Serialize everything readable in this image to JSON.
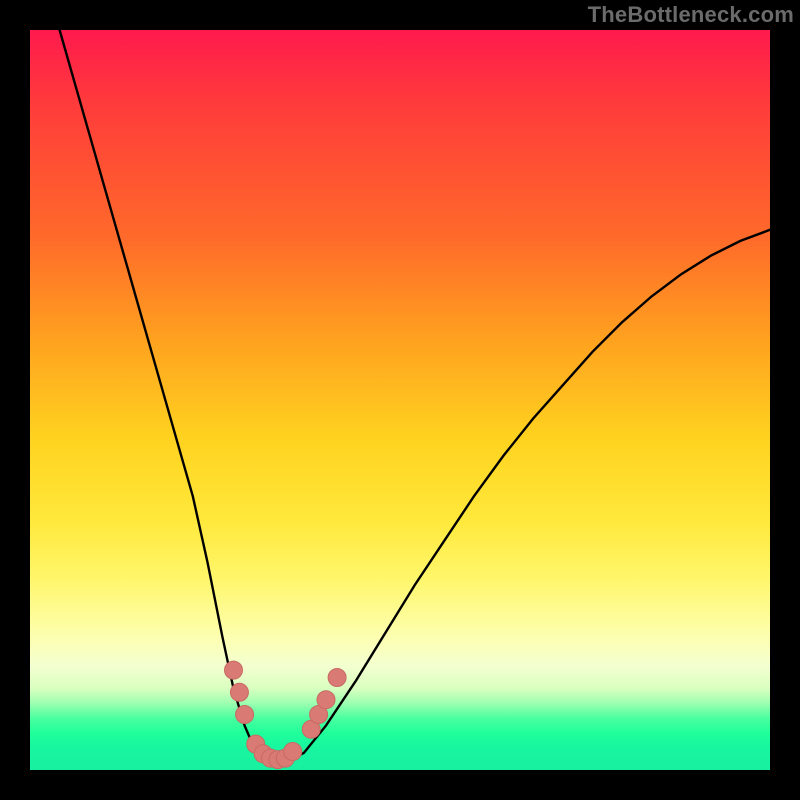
{
  "watermark": "TheBottleneck.com",
  "colors": {
    "frame": "#000000",
    "curve": "#000000",
    "marker_fill": "#d97b74",
    "marker_stroke": "#c86a63"
  },
  "chart_data": {
    "type": "line",
    "title": "",
    "xlabel": "",
    "ylabel": "",
    "xlim": [
      0,
      100
    ],
    "ylim": [
      0,
      100
    ],
    "series": [
      {
        "name": "bottleneck-curve",
        "x": [
          4,
          6,
          8,
          10,
          12,
          14,
          16,
          18,
          20,
          22,
          24,
          26,
          27.5,
          29,
          30.5,
          32,
          33.5,
          34,
          35,
          37,
          40,
          44,
          48,
          52,
          56,
          60,
          64,
          68,
          72,
          76,
          80,
          84,
          88,
          92,
          96,
          100
        ],
        "values": [
          100,
          93,
          86,
          79,
          72,
          65,
          58,
          51,
          44,
          37,
          28,
          18,
          11,
          6,
          2.5,
          1.3,
          1.1,
          1.1,
          1.3,
          2.3,
          6,
          12,
          18.5,
          25,
          31,
          37,
          42.5,
          47.5,
          52,
          56.5,
          60.5,
          64,
          67,
          69.5,
          71.5,
          73
        ]
      }
    ],
    "markers": [
      {
        "x": 27.5,
        "y": 13.5
      },
      {
        "x": 28.3,
        "y": 10.5
      },
      {
        "x": 29.0,
        "y": 7.5
      },
      {
        "x": 30.5,
        "y": 3.5
      },
      {
        "x": 31.5,
        "y": 2.2
      },
      {
        "x": 32.5,
        "y": 1.6
      },
      {
        "x": 33.5,
        "y": 1.4
      },
      {
        "x": 34.5,
        "y": 1.6
      },
      {
        "x": 35.5,
        "y": 2.5
      },
      {
        "x": 38.0,
        "y": 5.5
      },
      {
        "x": 39.0,
        "y": 7.5
      },
      {
        "x": 40.0,
        "y": 9.5
      },
      {
        "x": 41.5,
        "y": 12.5
      }
    ]
  }
}
